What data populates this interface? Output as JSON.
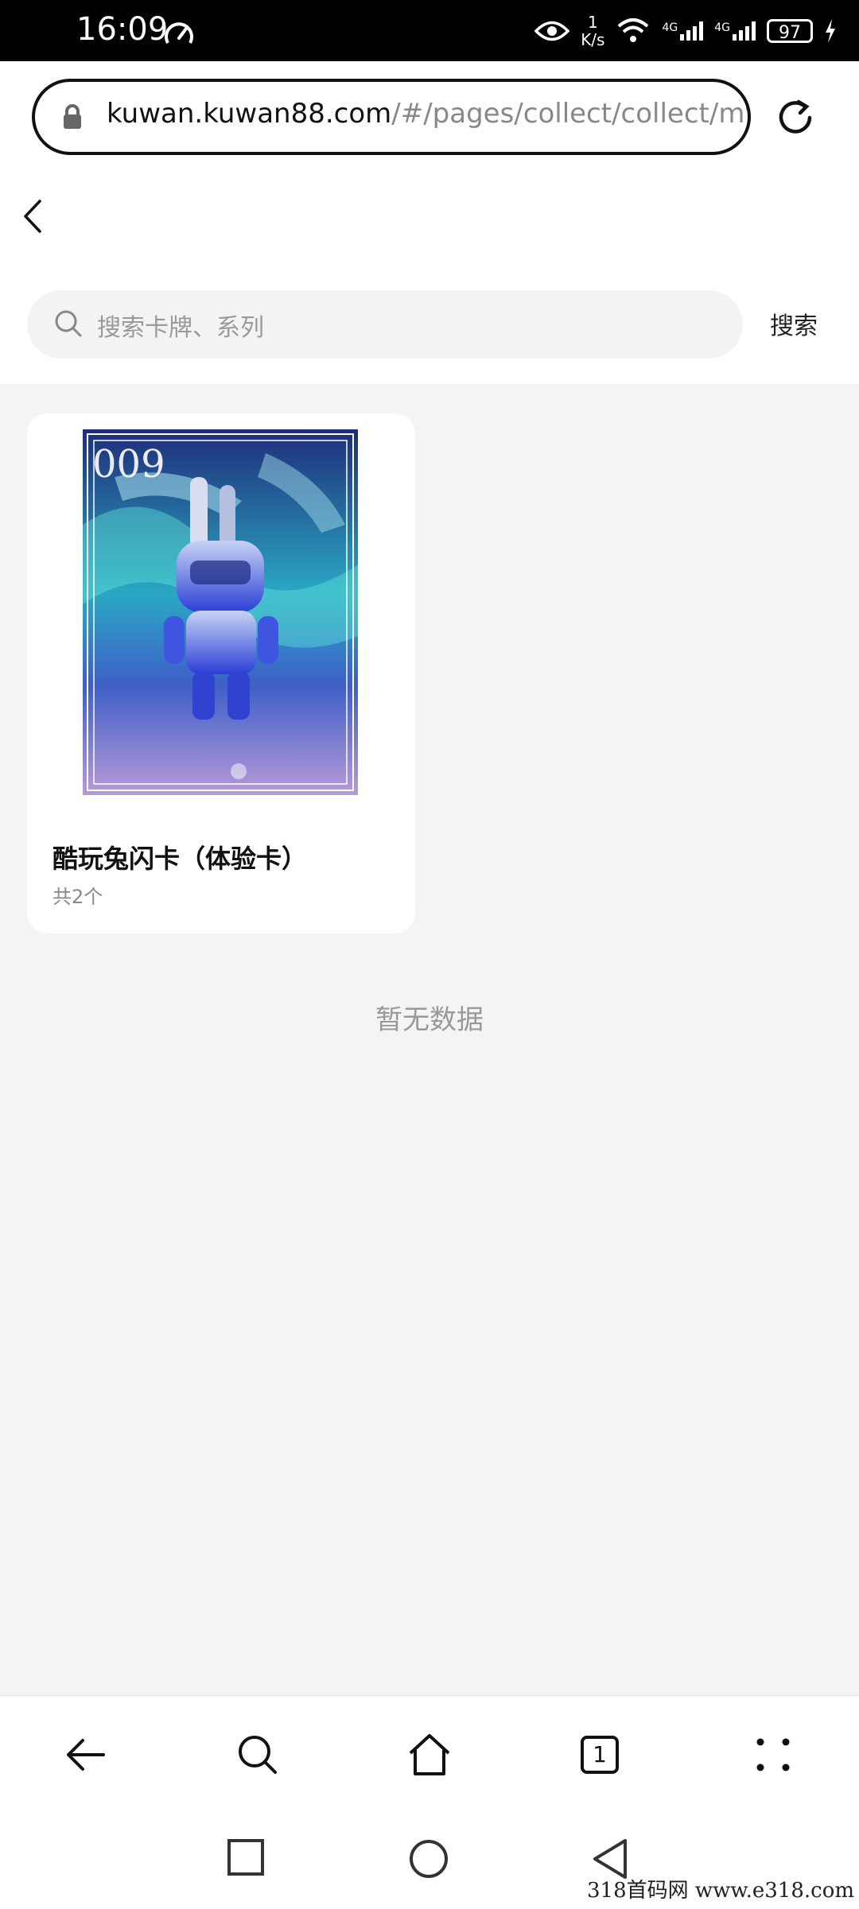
{
  "statusbar": {
    "time": "16:09",
    "net_speed_value": "1",
    "net_speed_unit": "K/s",
    "network_1": "4G",
    "network_2": "4G",
    "battery": "97"
  },
  "browser": {
    "url_domain": "kuwan.kuwan88.com",
    "url_path": "/#/pages/collect/collect/mycc"
  },
  "search": {
    "placeholder": "搜索卡牌、系列",
    "button_label": "搜索"
  },
  "cards": [
    {
      "image_number": "009",
      "title": "酷玩兔闪卡（体验卡）",
      "count": "共2个"
    }
  ],
  "empty_text": "暂无数据",
  "bottom_nav": {
    "tabs_count": "1"
  },
  "watermark": "318首码网   www.e318.com",
  "colors": {
    "background": "#f4f4f4",
    "card": "#ffffff",
    "statusbar": "#000000"
  }
}
